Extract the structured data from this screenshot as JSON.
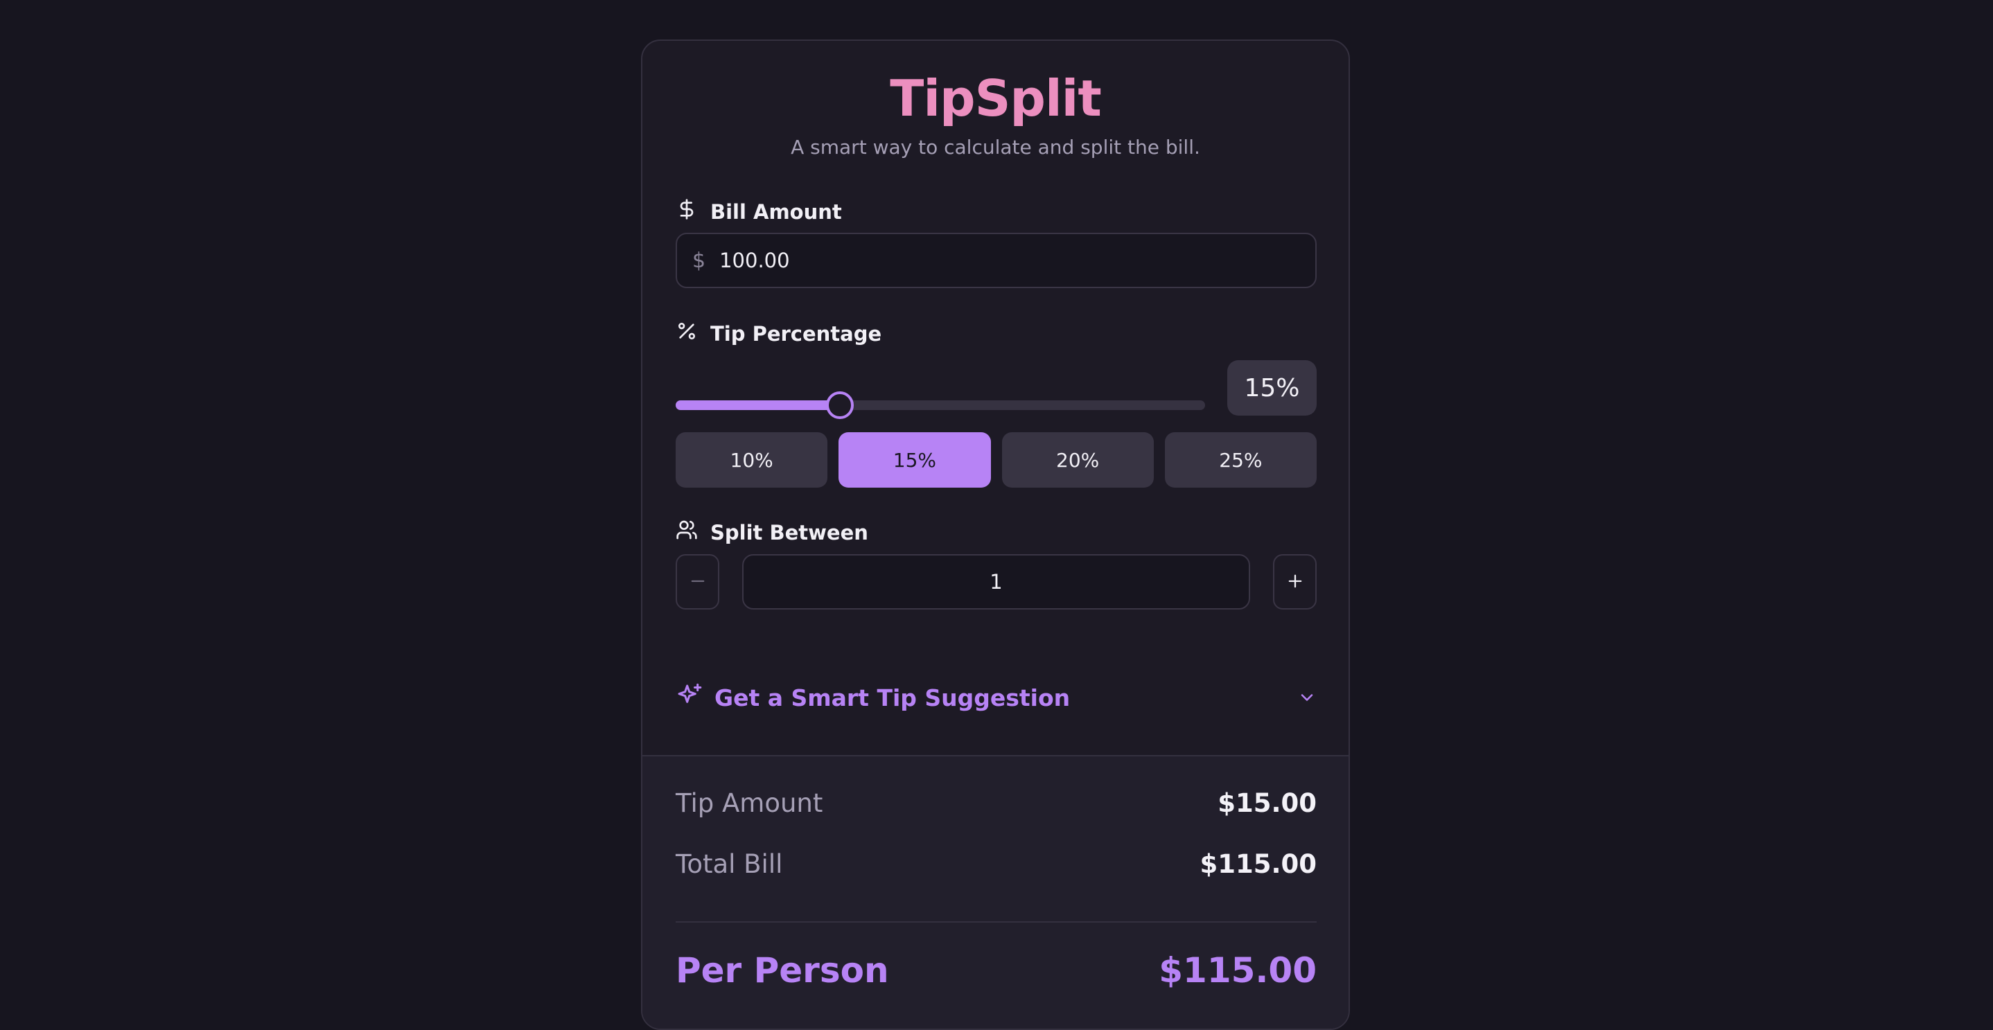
{
  "app": {
    "title": "TipSplit",
    "subtitle": "A smart way to calculate and split the bill."
  },
  "bill": {
    "label": "Bill Amount",
    "currency_symbol": "$",
    "value": "100.00",
    "icon": "dollar-icon"
  },
  "tip": {
    "label": "Tip Percentage",
    "icon": "percent-icon",
    "display": "15%",
    "slider_fraction": 0.31,
    "presets": [
      "10%",
      "15%",
      "20%",
      "25%"
    ],
    "active_preset": "15%"
  },
  "split": {
    "label": "Split Between",
    "icon": "users-icon",
    "value": "1"
  },
  "smart_tip": {
    "label": "Get a Smart Tip Suggestion",
    "icon": "sparkles-icon"
  },
  "results": {
    "tip_amount_label": "Tip Amount",
    "tip_amount_value": "$15.00",
    "total_label": "Total Bill",
    "total_value": "$115.00",
    "per_person_label": "Per Person",
    "per_person_value": "$115.00"
  },
  "colors": {
    "accent": "#b783f5",
    "brand_pink": "#ec8fbf",
    "background": "#17151f",
    "card": "#1d1a25"
  }
}
